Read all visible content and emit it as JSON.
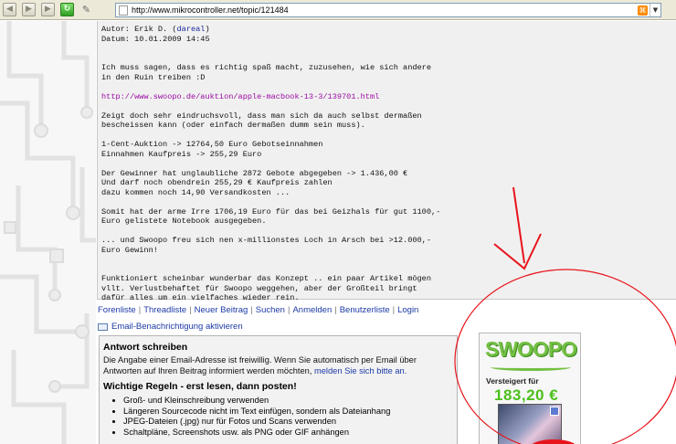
{
  "browser": {
    "url": "http://www.mikrocontroller.net/topic/121484",
    "icons": {
      "back": "left-arrow-icon",
      "forward": "right-arrow-icon",
      "reload": "reload-icon",
      "rss": "rss-icon"
    }
  },
  "post": {
    "author_prefix": "Autor: Erik D. (",
    "author_name": "dareal",
    "author_suffix": ")",
    "date": "Datum: 10.01.2009 14:45",
    "lines": [
      "Ich muss sagen, dass es richtig spaß macht, zuzusehen, wie sich andere",
      "in den Ruin treiben :D"
    ],
    "link": "http://www.swoopo.de/auktion/apple-macbook-13-3/139701.html",
    "para2": [
      "Zeigt doch sehr eindruchsvoll, dass man sich da auch selbst dermaßen",
      "bescheissen kann (oder einfach dermaßen dumm sein muss)."
    ],
    "para3": [
      "1-Cent-Auktion -> 12764,50 Euro Gebotseinnahmen",
      "Einnahmen Kaufpreis -> 255,29 Euro"
    ],
    "para4": [
      "Der Gewinner hat unglaubliche 2872 Gebote abgegeben -> 1.436,00 €",
      "Und darf noch obendrein 255,29 € Kaufpreis zahlen",
      "dazu kommen noch 14,90 Versandkosten ..."
    ],
    "para5": [
      "Somit hat der arme Irre 1706,19 Euro für das bei Geizhals für gut 1100,-",
      "Euro gelistete Notebook ausgegeben."
    ],
    "para6": [
      "... und Swoopo freu sich nen x-millionstes Loch in Arsch bei >12.000,-",
      "Euro Gewinn!"
    ],
    "para7": [
      "Funktioniert scheinbar wunderbar das Konzept .. ein paar Artikel mögen",
      "vllt. Verlustbehaftet für Swoopo weggehen, aber der Großteil bringt",
      "dafür alles um ein vielfaches wieder rein."
    ]
  },
  "nav": {
    "items": [
      "Forenliste",
      "Threadliste",
      "Neuer Beitrag",
      "Suchen",
      "Anmelden",
      "Benutzerliste",
      "Login"
    ],
    "separator": "|",
    "notify": "Email-Benachrichtigung aktivieren"
  },
  "reply": {
    "title": "Antwort schreiben",
    "intro": "Die Angabe einer Email-Adresse ist freiwillig. Wenn Sie automatisch per Email über Antworten auf Ihren Beitrag informiert werden möchten, ",
    "intro_link": "melden Sie sich bitte an.",
    "rules_title": "Wichtige Regeln - erst lesen, dann posten!",
    "rules": [
      "Groß- und Kleinschreibung verwenden",
      "Längeren Sourcecode nicht im Text einfügen, sondern als Dateianhang",
      "JPEG-Dateien (.jpg) nur für Fotos und Scans verwenden",
      "Schaltpläne, Screenshots usw. als PNG oder GIF anhängen"
    ]
  },
  "ad": {
    "logo": "SWOOPO",
    "label": "Versteigert für",
    "price": "183,20 €"
  },
  "colors": {
    "annotation": "#e8141b",
    "swoopo_green": "#73c043",
    "link": "#1c3aa6",
    "visited_link": "#9a0aa2"
  }
}
